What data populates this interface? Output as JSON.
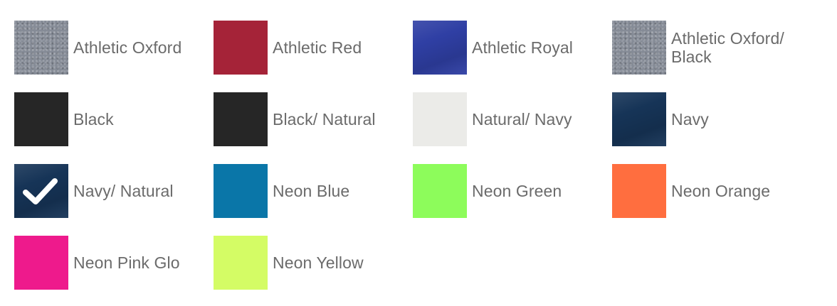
{
  "colors": [
    {
      "label": "Athletic Oxford",
      "swatch": "#858b96",
      "texture": "heather"
    },
    {
      "label": "Athletic Red",
      "swatch": "#a52338",
      "texture": "none"
    },
    {
      "label": "Athletic Royal",
      "swatch": "#2f3fa4",
      "texture": "sheen"
    },
    {
      "label": "Athletic Oxford/ Black",
      "swatch": "#858b96",
      "texture": "heather"
    },
    {
      "label": "Black",
      "swatch": "#262626",
      "texture": "none"
    },
    {
      "label": "Black/ Natural",
      "swatch": "#262626",
      "texture": "none"
    },
    {
      "label": "Natural/ Navy",
      "swatch": "#ebebe8",
      "texture": "none"
    },
    {
      "label": "Navy",
      "swatch": "#163457",
      "texture": "sheen"
    },
    {
      "label": "Navy/ Natural",
      "swatch": "#163457",
      "texture": "sheen",
      "selected": true
    },
    {
      "label": "Neon Blue",
      "swatch": "#0a76a8",
      "texture": "none"
    },
    {
      "label": "Neon Green",
      "swatch": "#8dfc5b",
      "texture": "none"
    },
    {
      "label": "Neon Orange",
      "swatch": "#ff6e3f",
      "texture": "none"
    },
    {
      "label": "Neon Pink Glo",
      "swatch": "#ee1a8c",
      "texture": "none"
    },
    {
      "label": "Neon Yellow",
      "swatch": "#d4fc65",
      "texture": "none"
    }
  ],
  "selected_icon": "checkmark-icon",
  "label_color": "#6b6b6b"
}
